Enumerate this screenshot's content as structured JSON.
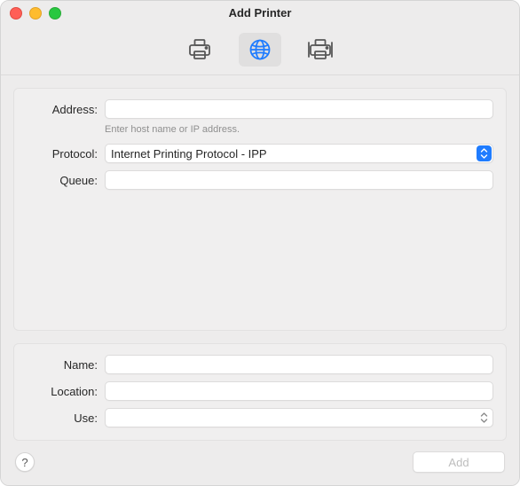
{
  "window": {
    "title": "Add Printer",
    "traffic": {
      "close": "close",
      "min": "minimize",
      "zoom": "zoom"
    }
  },
  "toolbar": {
    "tabs": [
      {
        "id": "default",
        "icon": "printer-icon",
        "selected": false
      },
      {
        "id": "ip",
        "icon": "globe-icon",
        "selected": true
      },
      {
        "id": "windows",
        "icon": "network-printer-icon",
        "selected": false
      }
    ]
  },
  "form_top": {
    "address": {
      "label": "Address:",
      "value": "",
      "hint": "Enter host name or IP address."
    },
    "protocol": {
      "label": "Protocol:",
      "value": "Internet Printing Protocol - IPP"
    },
    "queue": {
      "label": "Queue:",
      "value": ""
    }
  },
  "form_bottom": {
    "name": {
      "label": "Name:",
      "value": ""
    },
    "location": {
      "label": "Location:",
      "value": ""
    },
    "use": {
      "label": "Use:",
      "value": ""
    }
  },
  "footer": {
    "help_glyph": "?",
    "add_label": "Add"
  },
  "colors": {
    "accent": "#1f7cff"
  }
}
